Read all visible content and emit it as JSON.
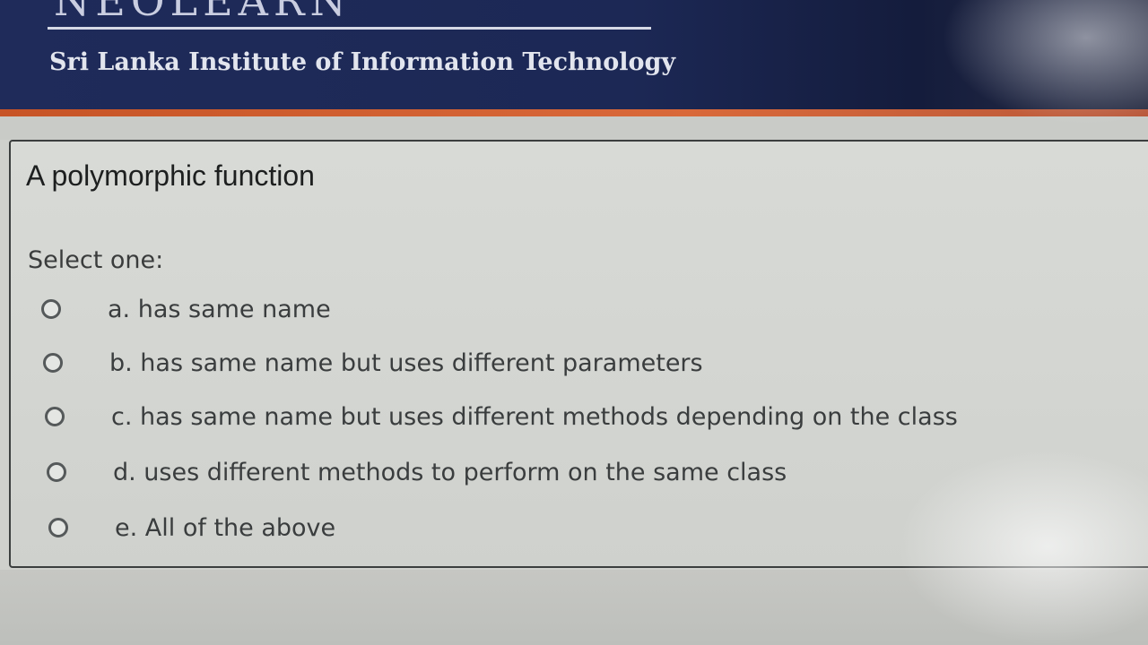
{
  "header": {
    "logo_partial": "NEOLEARN",
    "institution": "Sri Lanka Institute of Information Technology"
  },
  "question": {
    "text": "A polymorphic function",
    "prompt": "Select one:",
    "options": [
      {
        "label": "a. has same name",
        "selected": false
      },
      {
        "label": "b. has same name but uses different parameters",
        "selected": false
      },
      {
        "label": "c. has same name but uses different methods depending on the class",
        "selected": false
      },
      {
        "label": "d. uses different methods to perform on the same class",
        "selected": false
      },
      {
        "label": "e. All of the above",
        "selected": false
      }
    ]
  },
  "colors": {
    "header_bg": "#1f2b5a",
    "accent": "#c75426",
    "card_bg": "#d8dad6"
  }
}
